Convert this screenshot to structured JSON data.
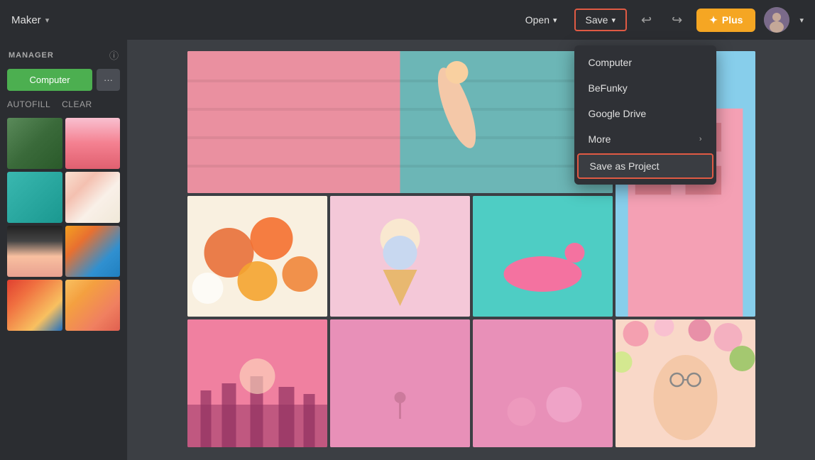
{
  "nav": {
    "maker_label": "Maker",
    "open_label": "Open",
    "save_label": "Save",
    "undo_icon": "↩",
    "redo_icon": "↪",
    "plus_label": "Plus",
    "chevron_down": "▾",
    "chevron_right": "›"
  },
  "save_dropdown": {
    "items": [
      {
        "label": "Computer",
        "has_arrow": false,
        "highlighted": false
      },
      {
        "label": "BeFunky",
        "has_arrow": false,
        "highlighted": false
      },
      {
        "label": "Google Drive",
        "has_arrow": false,
        "highlighted": false
      },
      {
        "label": "More",
        "has_arrow": true,
        "highlighted": false
      },
      {
        "label": "Save as Project",
        "has_arrow": false,
        "highlighted": true
      }
    ]
  },
  "sidebar": {
    "manager_label": "MANAGER",
    "info_icon": "ⓘ",
    "computer_btn": "Computer",
    "more_btn": "···",
    "autofill_label": "AUTOFILL",
    "clear_label": "CLEAR"
  },
  "colors": {
    "accent_green": "#4caf50",
    "accent_orange": "#f5a623",
    "accent_red": "#e05a44",
    "nav_bg": "#2b2d31",
    "dropdown_bg": "#2f3136"
  }
}
